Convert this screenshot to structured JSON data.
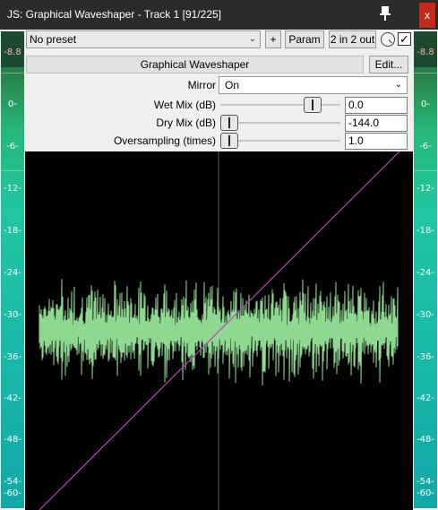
{
  "window": {
    "title": "JS: Graphical Waveshaper - Track 1 [91/225]",
    "pin_icon": "pin-icon",
    "close_label": "x"
  },
  "toolbar": {
    "preset": "No preset",
    "plus_label": "+",
    "param_label": "Param",
    "io_label": "2 in 2 out",
    "bypass_checked": true
  },
  "plugin": {
    "name": "Graphical Waveshaper",
    "edit_label": "Edit..."
  },
  "params": {
    "mirror": {
      "label": "Mirror",
      "value": "On"
    },
    "wet": {
      "label": "Wet Mix (dB)",
      "value": "0.0",
      "position": 0.82
    },
    "dry": {
      "label": "Dry Mix (dB)",
      "value": "-144.0",
      "position": 0.0
    },
    "oversampling": {
      "label": "Oversampling (times)",
      "value": "1.0",
      "position": 0.0
    }
  },
  "meters": {
    "peak_left": "-8.8",
    "peak_right": "-8.8",
    "ticks": [
      "0-",
      "-6-",
      "-12-",
      "-18-",
      "-24-",
      "-30-",
      "-36-",
      "-42-",
      "-48-",
      "-54-",
      "-60-"
    ]
  },
  "colors": {
    "curve": "#c040c0",
    "signal": "#8fd890",
    "meter_top": "#1f5a3a",
    "meter_bottom": "#12a8a8"
  }
}
